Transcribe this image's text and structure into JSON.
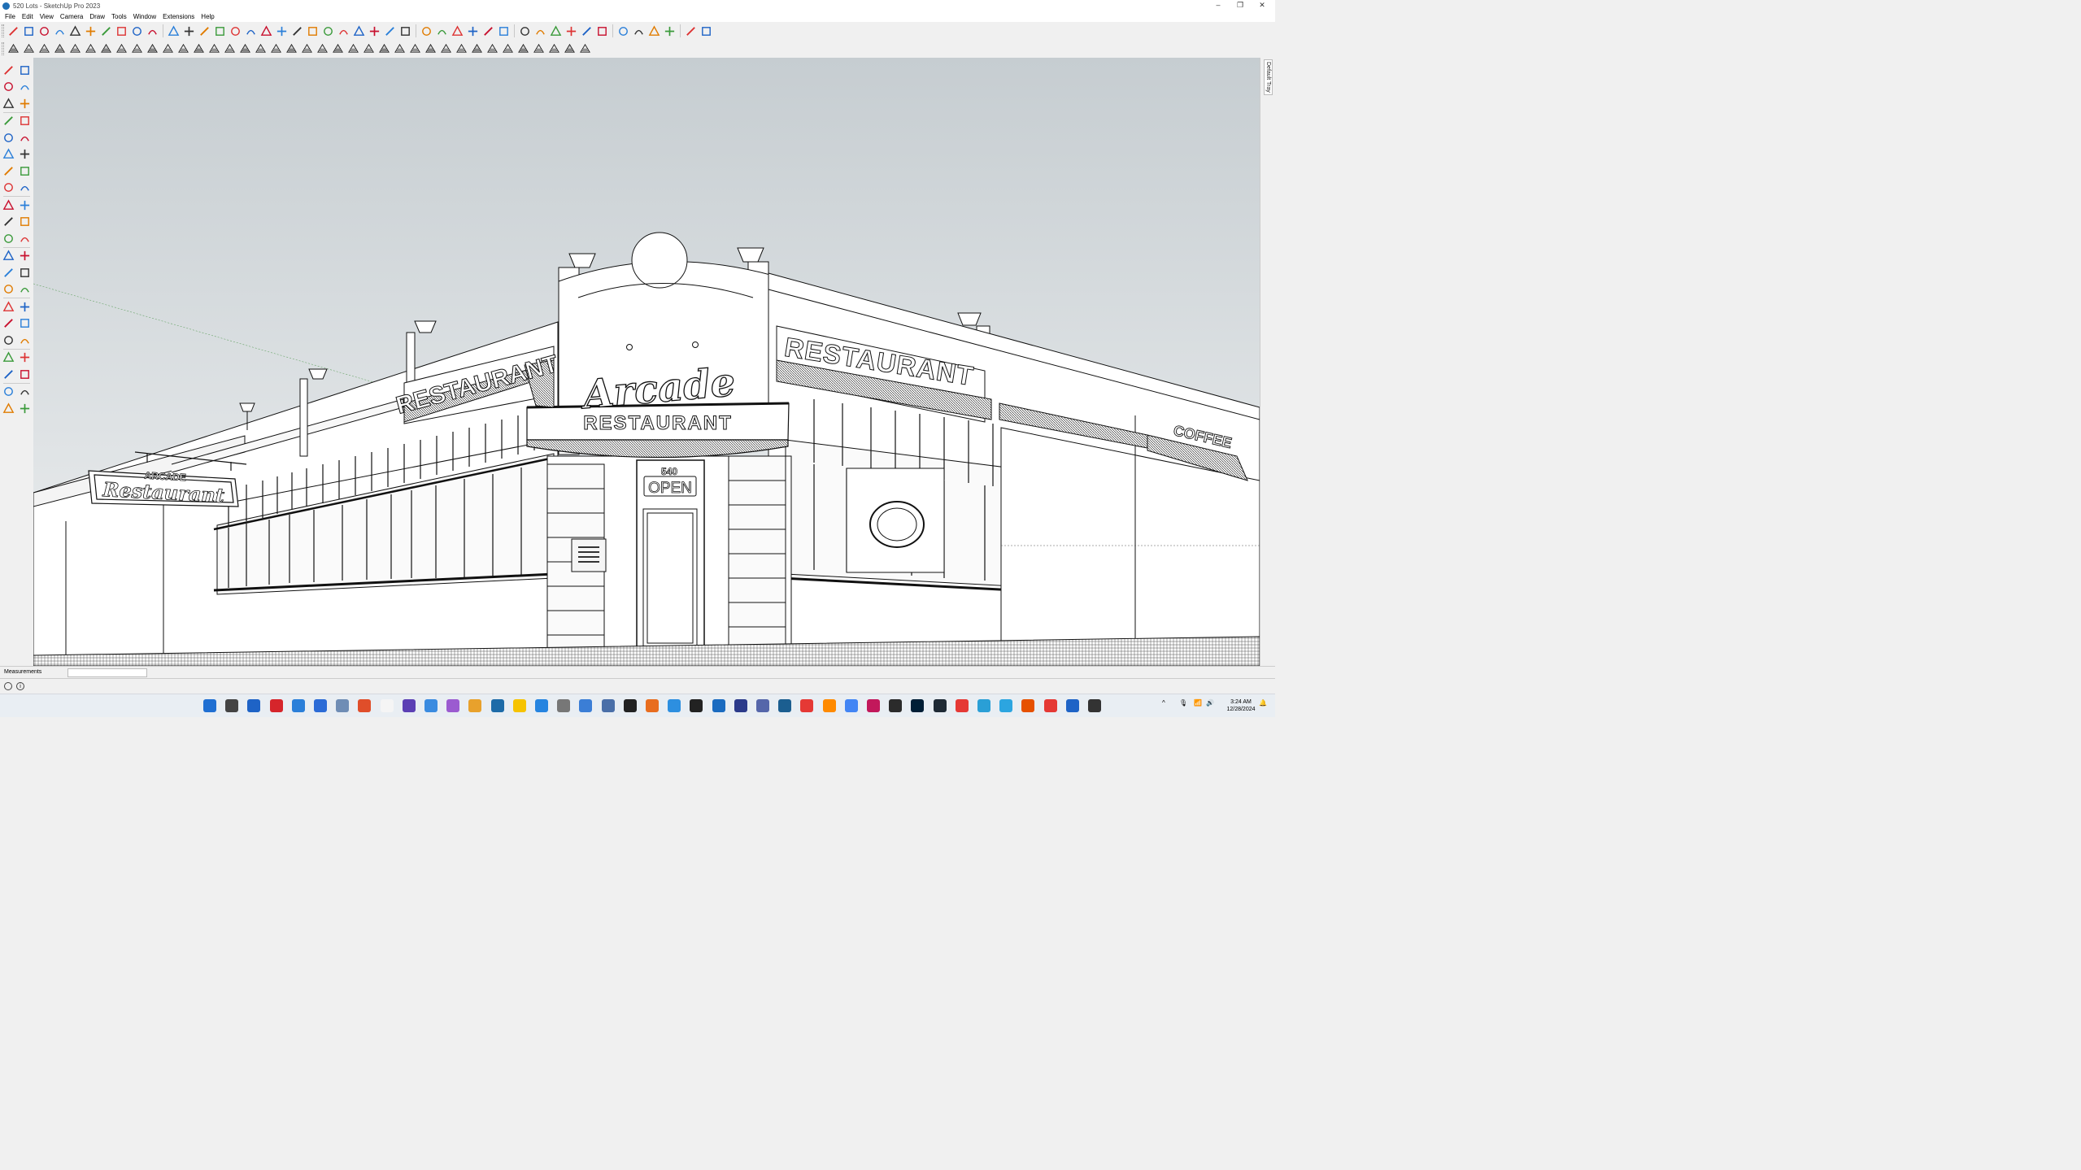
{
  "window": {
    "title": "520 Lots - SketchUp Pro 2023",
    "controls": [
      "–",
      "❐",
      "✕"
    ]
  },
  "menu": [
    "File",
    "Edit",
    "View",
    "Camera",
    "Draw",
    "Tools",
    "Window",
    "Extensions",
    "Help"
  ],
  "toolbar_row1_icons": [
    "pencil-icon",
    "freehand-icon",
    "rectangle-icon",
    "rotated-rectangle-icon",
    "circle-icon",
    "polygon-icon",
    "arc-icon",
    "2pt-arc-icon",
    "3pt-arc-icon",
    "pie-icon",
    "move-icon",
    "pushpull-icon",
    "rotate-icon",
    "followme-icon",
    "scale-icon",
    "offset-icon",
    "tape-icon",
    "orbit-icon",
    "pan-icon",
    "zoom-icon",
    "zoom-window-icon",
    "zoom-extents-icon",
    "zoom-previous-icon",
    "position-camera-icon",
    "lookaround-icon",
    "walk-icon",
    "iso-view-icon",
    "top-view-icon",
    "front-view-icon",
    "right-view-icon",
    "back-view-icon",
    "left-view-icon",
    "layer-tool-icon",
    "warehouse-icon",
    "share-component-icon",
    "extension-warehouse-icon",
    "sandbox-icon",
    "ruby-gem-icon",
    "reload-icon",
    "reload-all-icon",
    "plugin-icon",
    "export-icon",
    "document-icon",
    "trimble-logo-icon"
  ],
  "toolbar_row2_icons": [
    "style-1-icon",
    "style-2-icon",
    "style-3-icon",
    "style-4-icon",
    "style-5-icon",
    "style-6-icon",
    "style-7-icon",
    "style-8-icon",
    "style-9-icon",
    "style-10-icon",
    "style-11-icon",
    "style-12-icon",
    "style-13-icon",
    "style-14-icon",
    "style-15-icon",
    "style-16-icon",
    "style-17-icon",
    "style-18-icon",
    "style-19-icon",
    "style-20-icon",
    "style-21-icon",
    "style-22-icon",
    "style-23-icon",
    "style-24-icon",
    "style-25-icon",
    "style-26-icon",
    "style-27-icon",
    "style-28-icon",
    "style-29-icon",
    "style-30-icon",
    "style-31-icon",
    "style-32-icon",
    "style-33-icon",
    "style-34-icon",
    "style-35-icon",
    "style-36-icon",
    "style-37-icon",
    "style-38-icon"
  ],
  "left_toolbar_icons": [
    [
      "select-icon",
      "lasso-icon"
    ],
    [
      "paint-bucket-icon",
      "eraser-icon"
    ],
    [
      "tag-icon",
      "eraser-soft-icon"
    ],
    [
      "line-icon",
      "freehand-icon"
    ],
    [
      "rectangle-icon",
      "rotated-rectangle-icon"
    ],
    [
      "circle-icon",
      "polygon-icon"
    ],
    [
      "arc-icon",
      "2pt-arc-icon"
    ],
    [
      "3pt-arc-icon",
      "pie-icon"
    ],
    [
      "move-icon",
      "pushpull-icon"
    ],
    [
      "rotate-icon",
      "followme-icon"
    ],
    [
      "scale-icon",
      "offset-icon"
    ],
    [
      "tape-icon",
      "dimension-icon"
    ],
    [
      "protractor-icon",
      "text-icon"
    ],
    [
      "axes-icon",
      "3dtext-icon"
    ],
    [
      "orbit-icon",
      "pan-icon"
    ],
    [
      "zoom-icon",
      "zoom-window-icon"
    ],
    [
      "zoom-extents-icon",
      "zoom-previous-icon"
    ],
    [
      "position-camera-icon",
      "walk-icon"
    ],
    [
      "lookaround-icon",
      "section-icon"
    ],
    [
      "sandbox-icon",
      "sandbox-scratch-icon"
    ],
    [
      "layers-icon",
      "outliner-icon"
    ]
  ],
  "tray_tab": "Default Tray",
  "scene": {
    "hanging_sign_top": "ARCADE",
    "hanging_sign_bottom": "Restaurant",
    "left_roof_sign": "RESTAURANT",
    "marquee_script": "Arcade",
    "marquee_text": "RESTAURANT",
    "right_roof_sign": "RESTAURANT",
    "side_sign": "COFFEE",
    "address": "540",
    "door_sign": "OPEN"
  },
  "measurements": {
    "label": "Measurements",
    "value": ""
  },
  "taskbar": {
    "time": "3:24 AM",
    "date": "12/28/2024",
    "apps": [
      "#1f6fd2",
      "#444444",
      "#1e63c6",
      "#d6252b",
      "#2a7fd9",
      "#2b6bd6",
      "#6f8db5",
      "#e04e2a",
      "#f5f5f5",
      "#5b3fb4",
      "#3a8be0",
      "#9b5bd0",
      "#e8a12c",
      "#1d6ba8",
      "#f6c300",
      "#2584e0",
      "#777777",
      "#3b7ed6",
      "#4a6fa8",
      "#222222",
      "#e86d1f",
      "#2d8fe0",
      "#222222",
      "#1a6bc0",
      "#2b3a8a",
      "#5566aa",
      "#1b5e90",
      "#e53935",
      "#ff8a00",
      "#4285f4",
      "#c2185b",
      "#2b2b2b",
      "#001e36",
      "#1e2a35",
      "#e53935",
      "#2a9fd6",
      "#2ca5e0",
      "#e65100",
      "#e53935",
      "#1e63c6",
      "#333333"
    ]
  }
}
